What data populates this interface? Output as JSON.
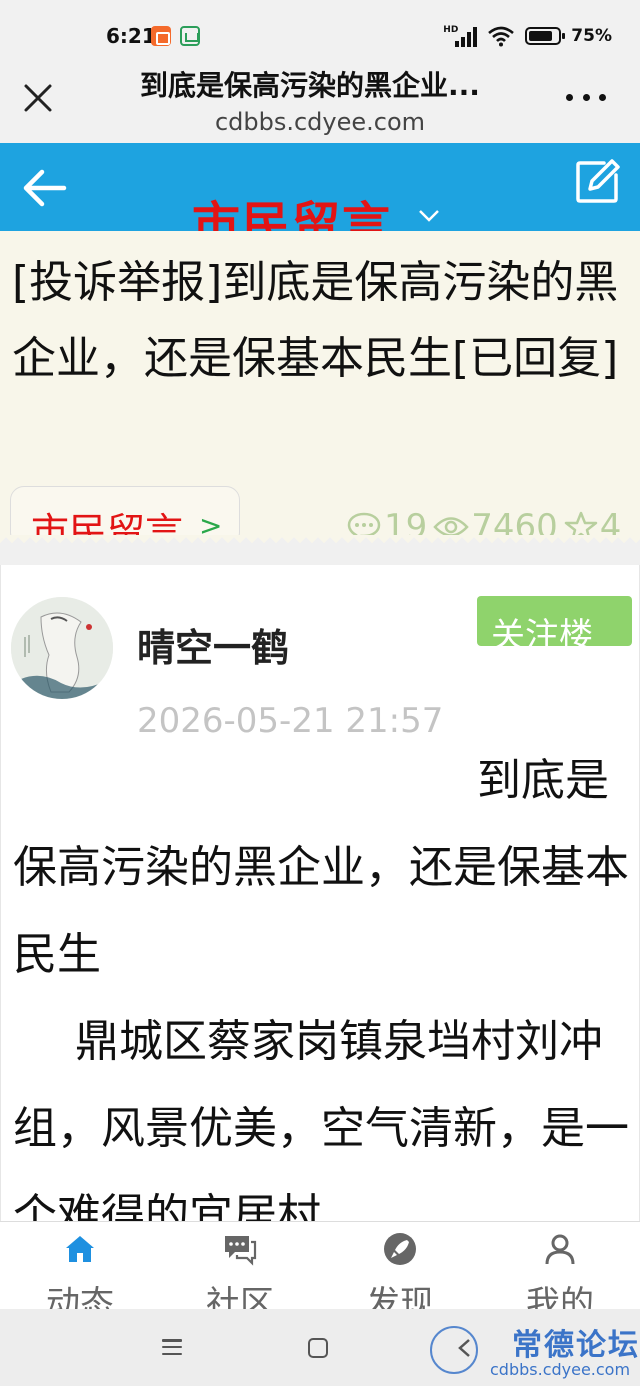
{
  "status_bar": {
    "time": "6:21",
    "network": "HD",
    "battery": "75%"
  },
  "browser": {
    "title": "到底是保高污染的黑企业...",
    "url": "cdbbs.cdyee.com"
  },
  "header": {
    "section_title": "市民留言",
    "accent_color": "#1ea3e0",
    "title_color": "#e21414"
  },
  "thread": {
    "title": "[投诉举报]到底是保高污染的黑企业，还是保基本民生[已回复]",
    "tag": "市民留言",
    "tag_arrow": ">",
    "replies": "19",
    "views": "7460",
    "stars": "4"
  },
  "post": {
    "author": "晴空一鹤",
    "follow_label": "关注楼",
    "time": "2026-05-21 21:57",
    "paragraphs": [
      "到底是保高污染的黑企业，还是保基本民生",
      "鼎城区蔡家岗镇泉垱村刘冲组，风景优美，空气清新，是一个难得的宜居村"
    ]
  },
  "tabs": [
    {
      "label": "动态",
      "icon": "home-icon"
    },
    {
      "label": "社区",
      "icon": "chat-icon"
    },
    {
      "label": "发现",
      "icon": "rocket-icon"
    },
    {
      "label": "我的",
      "icon": "user-icon"
    }
  ],
  "watermark": {
    "name": "常德论坛",
    "url": "cdbbs.cdyee.com"
  }
}
